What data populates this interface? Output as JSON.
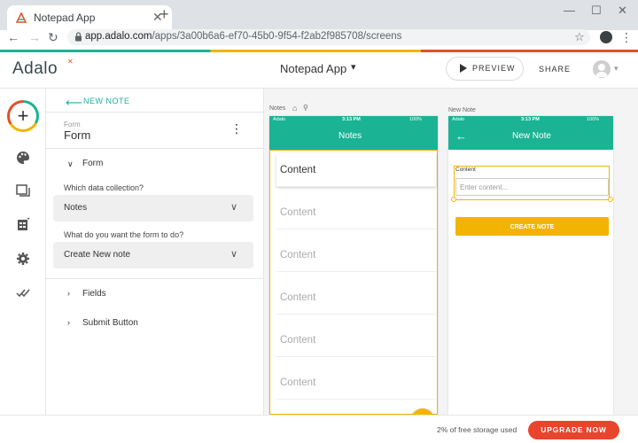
{
  "browser": {
    "tab_title": "Notepad App",
    "url_host": "app.adalo.com",
    "url_path": "/apps/3a00b6a6-ef70-45b0-9f54-f2ab2f985708/screens"
  },
  "header": {
    "logo": "Adalo",
    "app_name": "Notepad App",
    "preview_label": "PREVIEW",
    "share_label": "SHARE"
  },
  "rail": {
    "icons": [
      "add-icon",
      "palette-icon",
      "screens-icon",
      "database-icon",
      "settings-icon",
      "publish-icon"
    ]
  },
  "panel": {
    "back_label": "NEW NOTE",
    "form_subtitle": "Form",
    "form_title": "Form",
    "form_section": "Form",
    "collection_question": "Which data collection?",
    "collection_value": "Notes",
    "action_question": "What do you want the form to do?",
    "action_value": "Create New note",
    "fields_section": "Fields",
    "submit_section": "Submit Button"
  },
  "canvas": {
    "screen1": {
      "label": "Notes",
      "status_carrier": "Adalo",
      "status_time": "3:13 PM",
      "status_battery": "100%",
      "title": "Notes",
      "items": [
        "Content",
        "Content",
        "Content",
        "Content",
        "Content",
        "Content"
      ]
    },
    "screen2": {
      "label": "New Note",
      "status_carrier": "Adalo",
      "status_time": "3:13 PM",
      "status_battery": "100%",
      "title": "New Note",
      "field_label": "Content",
      "field_placeholder": "Enter content...",
      "button_label": "CREATE NOTE"
    }
  },
  "footer": {
    "storage_text": "2% of free storage used",
    "upgrade_label": "UPGRADE NOW"
  },
  "colors": {
    "teal": "#1ab394",
    "amber": "#f2b400",
    "red": "#e0502a"
  }
}
